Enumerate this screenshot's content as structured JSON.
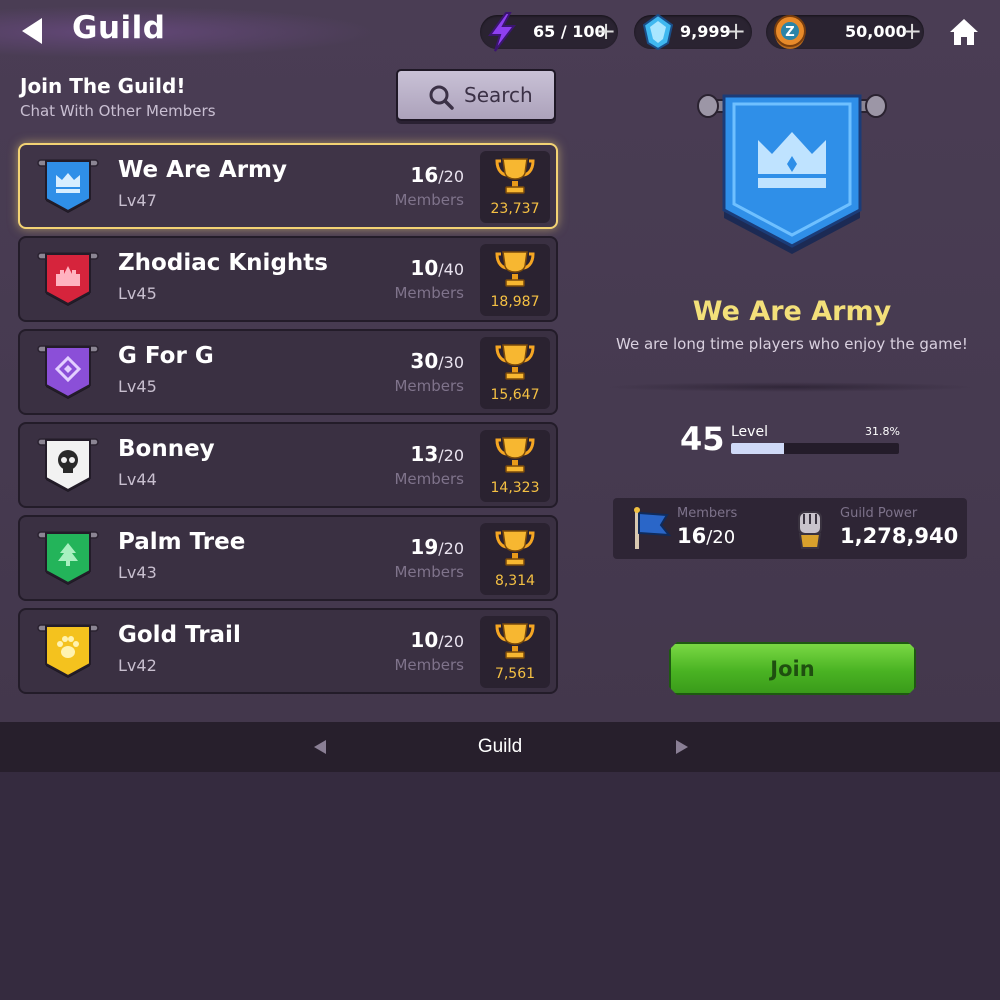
{
  "header": {
    "title": "Guild",
    "energy": "65 / 100",
    "gems": "9,999",
    "coins": "50,000",
    "plus_label": "+"
  },
  "left_panel": {
    "title": "Join The Guild!",
    "subtitle": "Chat With Other Members",
    "search_label": "Search"
  },
  "guilds": [
    {
      "name": "We Are Army",
      "level": "Lv47",
      "members": "16",
      "max": "/20",
      "members_label": "Members",
      "trophies": "23,737",
      "color": "#2f8fe8",
      "emblem": "crown-icon",
      "selected": true
    },
    {
      "name": "Zhodiac Knights",
      "level": "Lv45",
      "members": "10",
      "max": "/40",
      "members_label": "Members",
      "trophies": "18,987",
      "color": "#d6243c",
      "emblem": "castle-icon"
    },
    {
      "name": "G For G",
      "level": "Lv45",
      "members": "30",
      "max": "/30",
      "members_label": "Members",
      "trophies": "15,647",
      "color": "#8b4fd8",
      "emblem": "diamond-icon"
    },
    {
      "name": "Bonney",
      "level": "Lv44",
      "members": "13",
      "max": "/20",
      "members_label": "Members",
      "trophies": "14,323",
      "color": "#f2f2f2",
      "emblem": "skull-icon"
    },
    {
      "name": "Palm Tree",
      "level": "Lv43",
      "members": "19",
      "max": "/20",
      "members_label": "Members",
      "trophies": "8,314",
      "color": "#23b45a",
      "emblem": "tree-icon"
    },
    {
      "name": "Gold Trail",
      "level": "Lv42",
      "members": "10",
      "max": "/20",
      "members_label": "Members",
      "trophies": "7,561",
      "color": "#f4c21e",
      "emblem": "paw-icon"
    }
  ],
  "detail": {
    "name": "We Are Army",
    "description": "We are long time players who enjoy the game!",
    "level": "45",
    "level_label": "Level",
    "progress_text": "31.8%",
    "progress_fraction": 0.318,
    "members_label": "Members",
    "members": "16",
    "members_max": "/20",
    "power_label": "Guild Power",
    "power": "1,278,940",
    "join_label": "Join"
  },
  "bottom_nav": {
    "label": "Guild"
  }
}
